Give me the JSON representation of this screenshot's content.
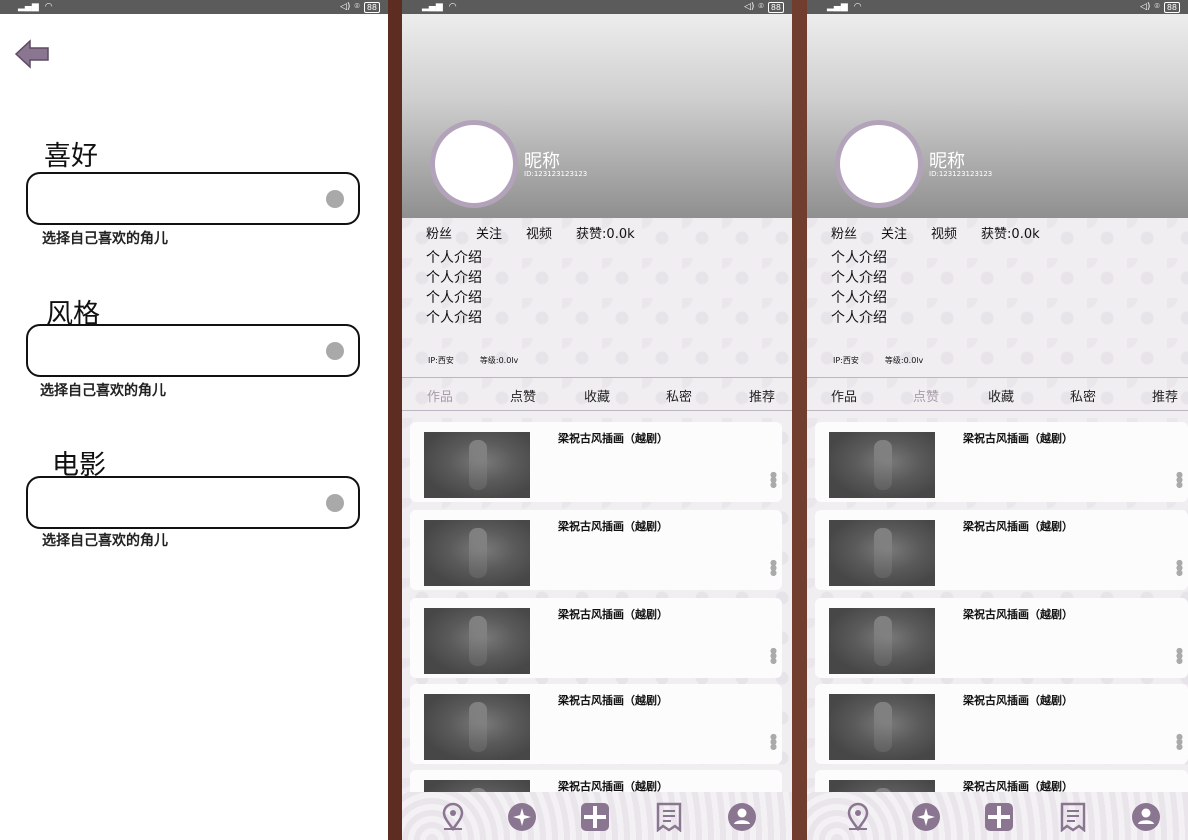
{
  "status": {
    "battery": "88"
  },
  "screen1": {
    "sections": [
      {
        "title": "喜好",
        "hint": "选择自己喜欢的角儿"
      },
      {
        "title": "风格",
        "hint": "选择自己喜欢的角儿"
      },
      {
        "title": "电影",
        "hint": "选择自己喜欢的角儿"
      }
    ]
  },
  "profile": {
    "nickname": "昵称",
    "id": "ID:123123123123",
    "stats": [
      "粉丝",
      "关注",
      "视频",
      "获赞:0.0k"
    ],
    "intro": [
      "个人介绍",
      "个人介绍",
      "个人介绍",
      "个人介绍"
    ],
    "ip": "IP:西安",
    "level": "等级:0.0lv",
    "tabs": [
      "作品",
      "点赞",
      "收藏",
      "私密",
      "推荐"
    ],
    "card_title": "梁祝古风插画（越剧）"
  },
  "colors": {
    "accent": "#a89aa8",
    "avatar_ring": "#b3a3ba",
    "nav_icon": "#8a7690"
  },
  "nav_icons": [
    "location-icon",
    "compass-icon",
    "add-icon",
    "notes-icon",
    "user-icon"
  ]
}
